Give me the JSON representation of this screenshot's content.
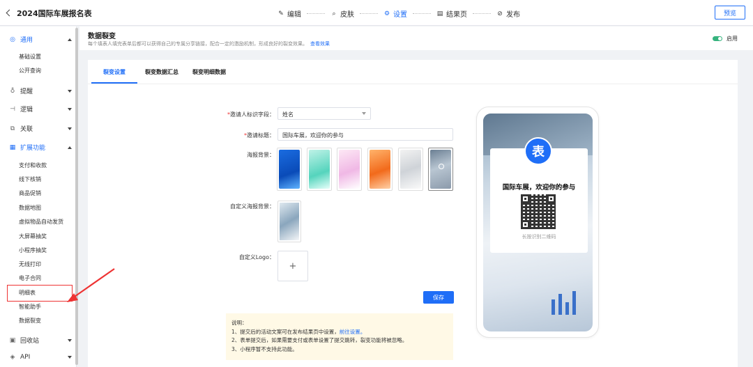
{
  "header": {
    "back_title": "2024国际车展报名表",
    "steps": [
      {
        "label": "编辑",
        "icon": "edit-icon"
      },
      {
        "label": "皮肤",
        "icon": "skin-icon"
      },
      {
        "label": "设置",
        "icon": "gear-icon"
      },
      {
        "label": "结果页",
        "icon": "document-icon"
      },
      {
        "label": "发布",
        "icon": "publish-icon"
      }
    ],
    "active_step": "设置",
    "preview_label": "预览"
  },
  "sidebar": {
    "groups": {
      "general": "通用",
      "remind": "提醒",
      "logic": "逻辑",
      "relation": "关联",
      "extend": "扩展功能",
      "recycle": "回收站",
      "api": "API"
    },
    "general_items": [
      "基础设置",
      "公开查询"
    ],
    "extend_items": [
      "支付和收款",
      "线下核销",
      "商品促销",
      "数据地图",
      "虚拟物品自动发货",
      "大屏幕抽奖",
      "小程序抽奖",
      "无线打印",
      "电子合同",
      "明细表",
      "智能助手",
      "数据裂变"
    ],
    "active_item": "数据裂变"
  },
  "section": {
    "title": "数据裂变",
    "description": "每个填表人填完表单后都可以获得自己的专属分享链接，配合一定的激励机制，形成良好的裂变效果。",
    "link": "查看效果",
    "toggle_label": "启用",
    "toggle_on": true
  },
  "tabs": [
    "裂变设置",
    "裂变数据汇总",
    "裂变明细数据"
  ],
  "form": {
    "inviter_label": "邀请人标识字段：",
    "inviter_value": "姓名",
    "title_label": "邀请标题：",
    "title_value": "国际车展，欢迎你的参与",
    "poster_label": "海报背景：",
    "custom_poster_label": "自定义海报背景：",
    "custom_logo_label": "自定义Logo：",
    "upload_plus": "+",
    "save_label": "保存"
  },
  "note": {
    "heading": "说明：",
    "line1_a": "1、提交后的活动文案可在发布结果页中设置，",
    "line1_link": "前往设置。",
    "line2": "2、表单提交后，如果需要支付或表单设置了提交跳转，裂变功能将被忽略。",
    "line3": "3、小程序暂不支持此功能。"
  },
  "phone_preview": {
    "logo_char": "表",
    "title": "国际车展，欢迎你的参与",
    "qr_caption": "长按识别二维码"
  },
  "colors": {
    "accent": "#1f6ef7",
    "toggle_on": "#36b37e",
    "highlight": "#e33333"
  }
}
